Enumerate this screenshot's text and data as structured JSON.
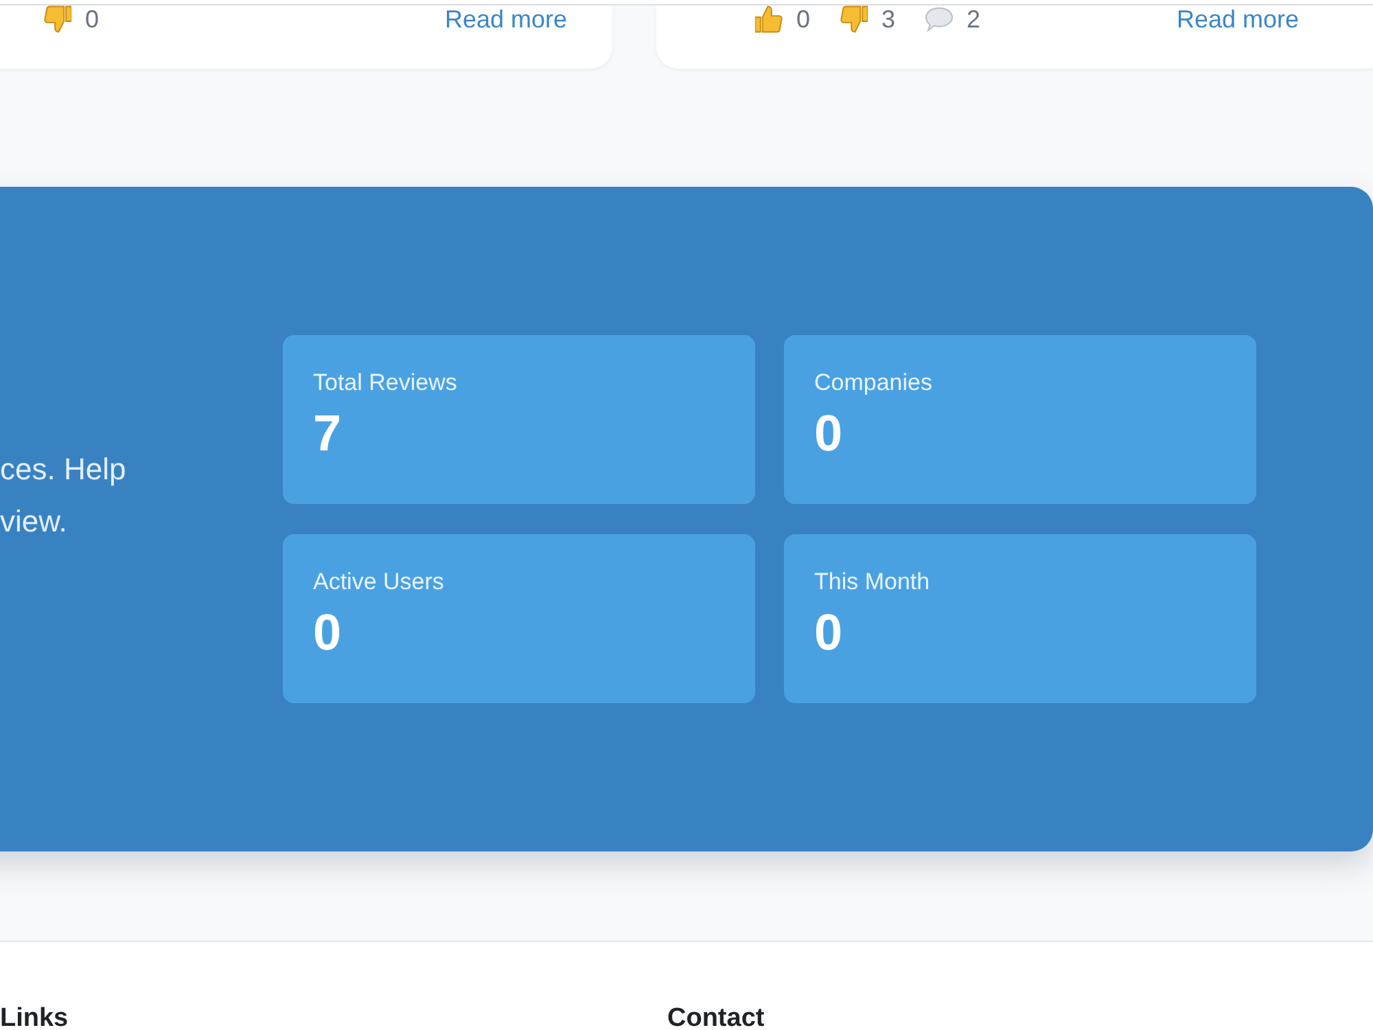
{
  "review_cards": [
    {
      "reactions": [
        {
          "kind": "dislike",
          "count": "0"
        }
      ],
      "link": "Read more"
    },
    {
      "reactions": [
        {
          "kind": "like",
          "count": "0"
        },
        {
          "kind": "dislike",
          "count": "3"
        },
        {
          "kind": "comment",
          "count": "2"
        }
      ],
      "link": "Read more"
    }
  ],
  "hero": {
    "intro_lines": [
      "ces. Help",
      "view."
    ],
    "stats": [
      {
        "label": "Total Reviews",
        "value": "7"
      },
      {
        "label": "Companies",
        "value": "0"
      },
      {
        "label": "Active Users",
        "value": "0"
      },
      {
        "label": "This Month",
        "value": "0"
      }
    ]
  },
  "footer": {
    "columns": [
      {
        "heading": "Links"
      },
      {
        "heading": "Contact"
      }
    ]
  }
}
